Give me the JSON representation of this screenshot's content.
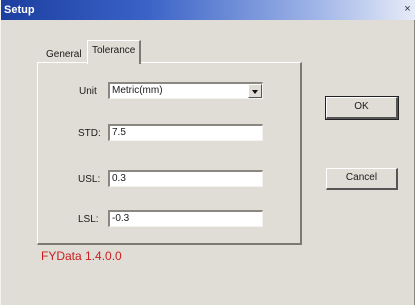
{
  "window": {
    "title": "Setup",
    "close_glyph": "×"
  },
  "tabs": [
    {
      "label": "General",
      "selected": false
    },
    {
      "label": "Tolerance",
      "selected": true
    }
  ],
  "form": {
    "unit": {
      "label": "Unit",
      "value": "Metric(mm)"
    },
    "std": {
      "label": "STD:",
      "value": "7.5"
    },
    "usl": {
      "label": "USL:",
      "value": "0.3"
    },
    "lsl": {
      "label": "LSL:",
      "value": "-0.3"
    }
  },
  "buttons": {
    "ok": "OK",
    "cancel": "Cancel"
  },
  "version_text": "FYData 1.4.0.0",
  "colors": {
    "title_bar": "#1c3fa0",
    "version_text": "#c82020",
    "dialog_bg": "#e0ddd6"
  }
}
